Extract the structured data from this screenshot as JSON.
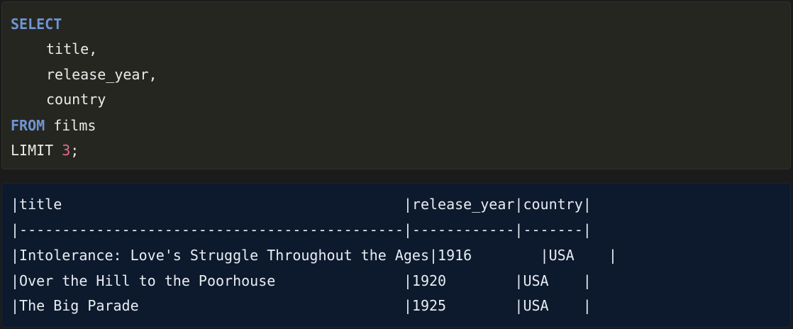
{
  "code": {
    "select_kw": "SELECT",
    "columns": [
      "title,",
      "release_year,",
      "country"
    ],
    "from_kw": "FROM",
    "table": " films",
    "limit_kw": "LIMIT ",
    "limit_value": "3",
    "terminator": ";"
  },
  "output": {
    "header": "|title                                        |release_year|country|",
    "separator": "|---------------------------------------------|------------|-------|",
    "rows": [
      "|Intolerance: Love's Struggle Throughout the Ages|1916        |USA    |",
      "|Over the Hill to the Poorhouse               |1920        |USA    |",
      "|The Big Parade                               |1925        |USA    |"
    ]
  }
}
